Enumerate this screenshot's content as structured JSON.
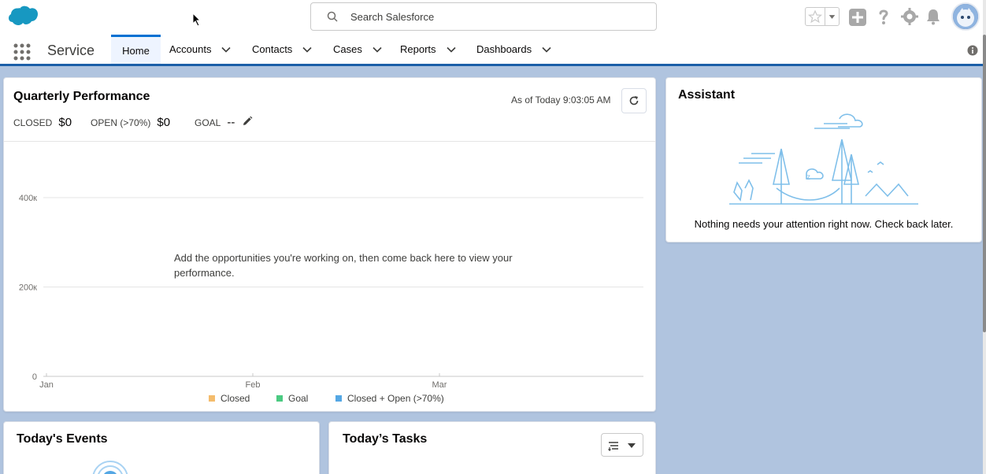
{
  "header": {
    "search": {
      "placeholder": "Search Salesforce"
    }
  },
  "nav": {
    "app_name": "Service",
    "items": [
      {
        "label": "Home",
        "active": true
      },
      {
        "label": "Accounts"
      },
      {
        "label": "Contacts"
      },
      {
        "label": "Cases"
      },
      {
        "label": "Reports"
      },
      {
        "label": "Dashboards"
      }
    ]
  },
  "quarterly_performance": {
    "title": "Quarterly Performance",
    "as_of": "As of Today 9:03:05 AM",
    "closed_label": "CLOSED",
    "closed_value": "$0",
    "open_label": "OPEN (>70%)",
    "open_value": "$0",
    "goal_label": "GOAL",
    "goal_value": "--",
    "empty_message": "Add the opportunities you're working on, then come back here to view your performance."
  },
  "chart_data": {
    "type": "line",
    "x": [
      "Jan",
      "Feb",
      "Mar"
    ],
    "ytick_labels": [
      "0",
      "200к",
      "400к"
    ],
    "yticks": [
      0,
      200000,
      400000
    ],
    "series": [
      {
        "name": "Closed",
        "values": []
      },
      {
        "name": "Goal",
        "values": []
      },
      {
        "name": "Closed + Open (>70%)",
        "values": []
      }
    ],
    "legend_placement": "bottom",
    "grid": true,
    "colors": {
      "Closed": "#f4bc6c",
      "Goal": "#4bca81",
      "Closed + Open (>70%)": "#54a7e4"
    }
  },
  "assistant": {
    "title": "Assistant",
    "message": "Nothing needs your attention right now. Check back later."
  },
  "events": {
    "title": "Today's Events"
  },
  "tasks": {
    "title": "Today’s Tasks"
  },
  "colors": {
    "brand_blue": "#0070d2",
    "nav_underline": "#1b5fa8",
    "page_bg": "#b0c4df"
  }
}
